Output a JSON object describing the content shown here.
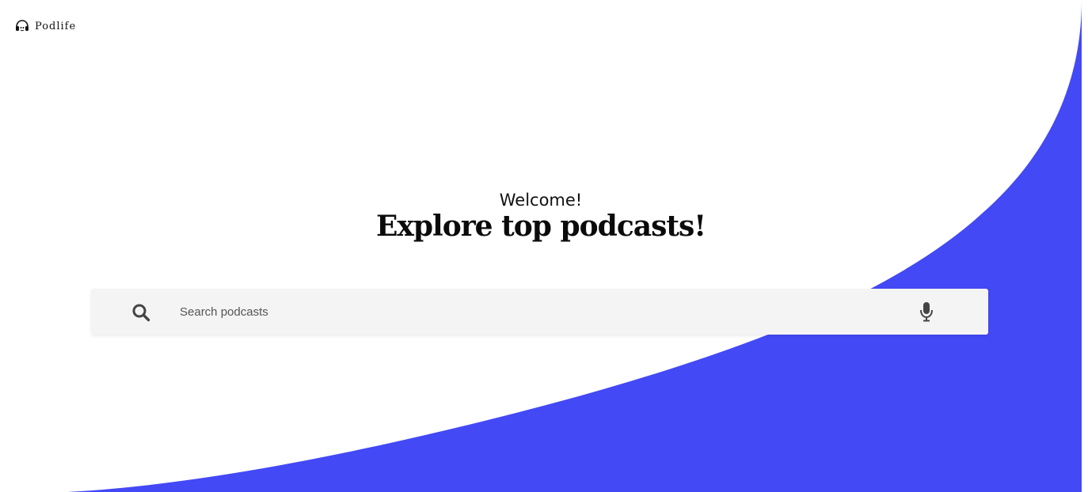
{
  "header": {
    "brand_name": "Podlife",
    "brand_icon": "headphones-icon"
  },
  "hero": {
    "subtitle": "Welcome!",
    "title": "Explore top podcasts!"
  },
  "search": {
    "placeholder": "Search podcasts",
    "value": "",
    "search_icon": "search-icon",
    "mic_icon": "microphone-icon"
  },
  "colors": {
    "accent": "#4349f5",
    "background": "#ffffff",
    "search_bar": "#f4f4f4"
  }
}
